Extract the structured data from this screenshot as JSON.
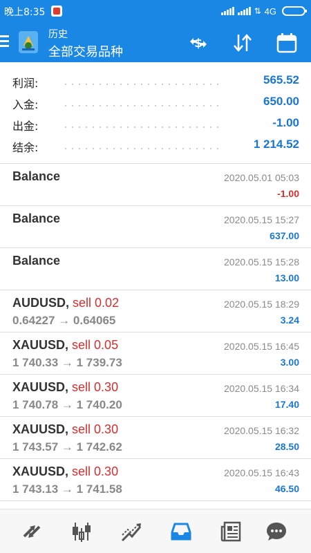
{
  "status_bar": {
    "time": "晚上8:35",
    "network": "4G"
  },
  "toolbar": {
    "title": "历史",
    "subtitle": "全部交易品种"
  },
  "summary": [
    {
      "label": "利润:",
      "value": "565.52"
    },
    {
      "label": "入金:",
      "value": "650.00"
    },
    {
      "label": "出金:",
      "value": "-1.00"
    },
    {
      "label": "结余:",
      "value": "1 214.52"
    }
  ],
  "trades": [
    {
      "symbol": "Balance",
      "side": "",
      "prices": "",
      "time": "2020.05.01 05:03",
      "profit": "-1.00",
      "profit_sign": "neg"
    },
    {
      "symbol": "Balance",
      "side": "",
      "prices": "",
      "time": "2020.05.15 15:27",
      "profit": "637.00",
      "profit_sign": "pos"
    },
    {
      "symbol": "Balance",
      "side": "",
      "prices": "",
      "time": "2020.05.15 15:28",
      "profit": "13.00",
      "profit_sign": "pos"
    },
    {
      "symbol": "AUDUSD,",
      "side": "sell 0.02",
      "prices": "0.64227 → 0.64065",
      "time": "2020.05.15 18:29",
      "profit": "3.24",
      "profit_sign": "pos"
    },
    {
      "symbol": "XAUUSD,",
      "side": "sell 0.05",
      "prices": "1 740.33 → 1 739.73",
      "time": "2020.05.15 16:45",
      "profit": "3.00",
      "profit_sign": "pos"
    },
    {
      "symbol": "XAUUSD,",
      "side": "sell 0.30",
      "prices": "1 740.78 → 1 740.20",
      "time": "2020.05.15 16:34",
      "profit": "17.40",
      "profit_sign": "pos"
    },
    {
      "symbol": "XAUUSD,",
      "side": "sell 0.30",
      "prices": "1 743.57 → 1 742.62",
      "time": "2020.05.15 16:32",
      "profit": "28.50",
      "profit_sign": "pos"
    },
    {
      "symbol": "XAUUSD,",
      "side": "sell 0.30",
      "prices": "1 743.13 → 1 741.58",
      "time": "2020.05.15 16:43",
      "profit": "46.50",
      "profit_sign": "pos"
    }
  ],
  "colors": {
    "primary": "#1a87e5",
    "profit_positive": "#1976d2",
    "profit_negative": "#d32f2f",
    "nav_active": "#1a87e5",
    "nav_inactive": "#555555"
  },
  "bottom_nav": [
    {
      "icon": "quotes-arrows-icon",
      "active": false
    },
    {
      "icon": "candlestick-chart-icon",
      "active": false
    },
    {
      "icon": "trade-line-icon",
      "active": false
    },
    {
      "icon": "inbox-history-icon",
      "active": true
    },
    {
      "icon": "news-icon",
      "active": false
    },
    {
      "icon": "chat-bubble-icon",
      "active": false
    }
  ]
}
